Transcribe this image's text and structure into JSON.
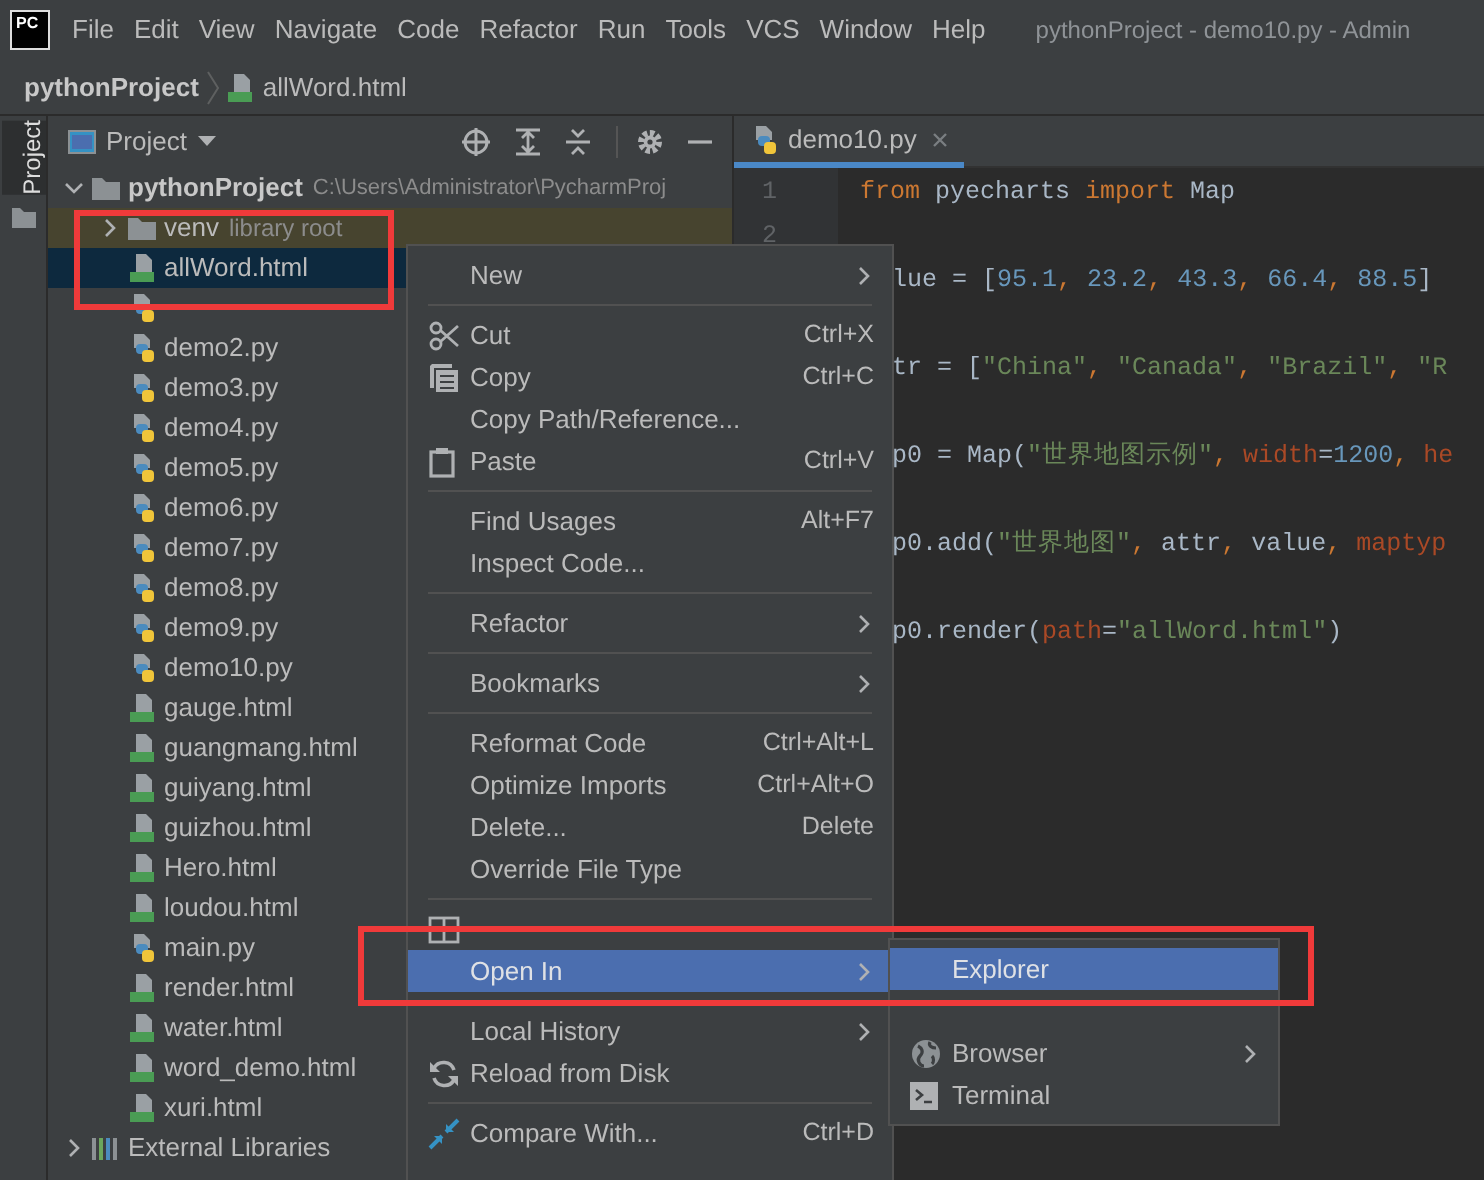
{
  "menu_bar": {
    "logo": "PC",
    "items": [
      "File",
      "Edit",
      "View",
      "Navigate",
      "Code",
      "Refactor",
      "Run",
      "Tools",
      "VCS",
      "Window",
      "Help"
    ],
    "title": "pythonProject - demo10.py - Admin"
  },
  "breadcrumb": [
    {
      "label": "pythonProject",
      "kind": "project"
    },
    {
      "label": "allWord.html",
      "kind": "html"
    }
  ],
  "tool_strip": {
    "tabs": [
      {
        "label": "Project",
        "selected": true
      }
    ]
  },
  "project_panel": {
    "title": "Project",
    "tree": [
      {
        "label": "pythonProject",
        "kind": "folder",
        "path": "C:\\Users\\Administrator\\PycharmProj",
        "expanded": true,
        "selected": false,
        "children": [
          {
            "label": "venv",
            "note": "library root",
            "kind": "folder",
            "expanded": false,
            "excluded": true,
            "selected": false
          },
          {
            "label": "allWord.html",
            "kind": "html",
            "selected": true
          },
          {
            "kind": "py",
            "selected": false
          },
          {
            "label": "demo2.py",
            "kind": "py",
            "selected": false
          },
          {
            "label": "demo3.py",
            "kind": "py",
            "selected": false
          },
          {
            "label": "demo4.py",
            "kind": "py",
            "selected": false
          },
          {
            "label": "demo5.py",
            "kind": "py",
            "selected": false
          },
          {
            "label": "demo6.py",
            "kind": "py",
            "selected": false
          },
          {
            "label": "demo7.py",
            "kind": "py",
            "selected": false
          },
          {
            "label": "demo8.py",
            "kind": "py",
            "selected": false
          },
          {
            "label": "demo9.py",
            "kind": "py",
            "selected": false
          },
          {
            "label": "demo10.py",
            "kind": "py",
            "selected": false
          },
          {
            "label": "gauge.html",
            "kind": "html",
            "selected": false
          },
          {
            "label": "guangmang.html",
            "kind": "html",
            "selected": false
          },
          {
            "label": "guiyang.html",
            "kind": "html",
            "selected": false
          },
          {
            "label": "guizhou.html",
            "kind": "html",
            "selected": false
          },
          {
            "label": "Hero.html",
            "kind": "html",
            "selected": false
          },
          {
            "label": "loudou.html",
            "kind": "html",
            "selected": false
          },
          {
            "label": "main.py",
            "kind": "py",
            "selected": false
          },
          {
            "label": "render.html",
            "kind": "html",
            "selected": false
          },
          {
            "label": "water.html",
            "kind": "html",
            "selected": false
          },
          {
            "label": "word_demo.html",
            "kind": "html",
            "selected": false
          },
          {
            "label": "xuri.html",
            "kind": "html",
            "selected": false
          }
        ]
      },
      {
        "label": "External Libraries",
        "kind": "library",
        "expanded": false,
        "selected": false
      }
    ]
  },
  "editor": {
    "tabs": [
      {
        "label": "demo10.py",
        "selected": true
      }
    ],
    "line_numbers": [
      "1",
      "2"
    ],
    "lines": [
      {
        "tokens": [
          {
            "text": "from",
            "kind": "keyword"
          },
          {
            "text": " pyecharts ",
            "kind": "plain"
          },
          {
            "text": "import",
            "kind": "keyword"
          },
          {
            "text": " Map",
            "kind": "plain"
          }
        ]
      },
      {
        "tokens": [
          {
            "text": "lue = [",
            "kind": "plain"
          },
          {
            "text": "95.1",
            "kind": "number"
          },
          {
            "text": ", ",
            "kind": "keyword"
          },
          {
            "text": "23.2",
            "kind": "number"
          },
          {
            "text": ", ",
            "kind": "keyword"
          },
          {
            "text": "43.3",
            "kind": "number"
          },
          {
            "text": ", ",
            "kind": "keyword"
          },
          {
            "text": "66.4",
            "kind": "number"
          },
          {
            "text": ", ",
            "kind": "keyword"
          },
          {
            "text": "88.5",
            "kind": "number"
          },
          {
            "text": "]",
            "kind": "plain"
          }
        ]
      },
      {
        "tokens": [
          {
            "text": "tr = [",
            "kind": "plain"
          },
          {
            "text": "\"China\"",
            "kind": "string"
          },
          {
            "text": ", ",
            "kind": "keyword"
          },
          {
            "text": "\"Canada\"",
            "kind": "string"
          },
          {
            "text": ", ",
            "kind": "keyword"
          },
          {
            "text": "\"Brazil\"",
            "kind": "string"
          },
          {
            "text": ", ",
            "kind": "keyword"
          },
          {
            "text": "\"R",
            "kind": "string"
          }
        ]
      },
      {
        "tokens": [
          {
            "text": "p0 = Map(",
            "kind": "plain"
          },
          {
            "text": "\"世界地图示例\"",
            "kind": "string"
          },
          {
            "text": ", ",
            "kind": "keyword"
          },
          {
            "text": "width",
            "kind": "param"
          },
          {
            "text": "=",
            "kind": "plain"
          },
          {
            "text": "1200",
            "kind": "number"
          },
          {
            "text": ", ",
            "kind": "keyword"
          },
          {
            "text": "he",
            "kind": "param"
          }
        ]
      },
      {
        "tokens": [
          {
            "text": "p0.add(",
            "kind": "plain"
          },
          {
            "text": "\"世界地图\"",
            "kind": "string"
          },
          {
            "text": ", ",
            "kind": "keyword"
          },
          {
            "text": "attr",
            "kind": "plain"
          },
          {
            "text": ", ",
            "kind": "keyword"
          },
          {
            "text": "value",
            "kind": "plain"
          },
          {
            "text": ", ",
            "kind": "keyword"
          },
          {
            "text": "maptyp",
            "kind": "param"
          }
        ]
      },
      {
        "tokens": [
          {
            "text": "p0.render(",
            "kind": "plain"
          },
          {
            "text": "path",
            "kind": "param"
          },
          {
            "text": "=",
            "kind": "plain"
          },
          {
            "text": "\"allWord.html\"",
            "kind": "string"
          },
          {
            "text": ")",
            "kind": "plain"
          }
        ]
      }
    ]
  },
  "context_menu": {
    "items": [
      {
        "kind": "item",
        "label": "New",
        "has_submenu": true,
        "selected": false
      },
      {
        "kind": "separator"
      },
      {
        "kind": "item",
        "label": "Cut",
        "shortcut": "Ctrl+X",
        "has_submenu": false,
        "selected": false
      },
      {
        "kind": "item",
        "label": "Copy",
        "shortcut": "Ctrl+C",
        "has_submenu": false,
        "selected": false
      },
      {
        "kind": "item",
        "label": "Copy Path/Reference...",
        "has_submenu": false,
        "selected": false
      },
      {
        "kind": "item",
        "label": "Paste",
        "shortcut": "Ctrl+V",
        "has_submenu": false,
        "selected": false
      },
      {
        "kind": "separator"
      },
      {
        "kind": "item",
        "label": "Find Usages",
        "shortcut": "Alt+F7",
        "has_submenu": false,
        "selected": false
      },
      {
        "kind": "item",
        "label": "Inspect Code...",
        "has_submenu": false,
        "selected": false
      },
      {
        "kind": "separator"
      },
      {
        "kind": "item",
        "label": "Refactor",
        "has_submenu": true,
        "selected": false
      },
      {
        "kind": "separator"
      },
      {
        "kind": "item",
        "label": "Bookmarks",
        "has_submenu": true,
        "selected": false
      },
      {
        "kind": "separator"
      },
      {
        "kind": "item",
        "label": "Reformat Code",
        "shortcut": "Ctrl+Alt+L",
        "has_submenu": false,
        "selected": false
      },
      {
        "kind": "item",
        "label": "Optimize Imports",
        "shortcut": "Ctrl+Alt+O",
        "has_submenu": false,
        "selected": false
      },
      {
        "kind": "item",
        "label": "Delete...",
        "shortcut": "Delete",
        "has_submenu": false,
        "selected": false
      },
      {
        "kind": "item",
        "label": "Override File Type",
        "has_submenu": false,
        "selected": false
      },
      {
        "kind": "separator"
      },
      {
        "kind": "item",
        "has_submenu": false,
        "selected": false
      },
      {
        "kind": "item",
        "label": "Open In",
        "has_submenu": true,
        "selected": true
      },
      {
        "kind": "separator"
      },
      {
        "kind": "item",
        "label": "Local History",
        "has_submenu": true,
        "selected": false
      },
      {
        "kind": "item",
        "label": "Reload from Disk",
        "has_submenu": false,
        "selected": false
      },
      {
        "kind": "separator"
      },
      {
        "kind": "item",
        "label": "Compare With...",
        "shortcut": "Ctrl+D",
        "has_submenu": false,
        "selected": false
      }
    ]
  },
  "submenu": {
    "items": [
      {
        "kind": "item",
        "label": "Explorer",
        "has_submenu": false,
        "selected": true
      },
      {
        "kind": "item",
        "has_submenu": false,
        "selected": false
      },
      {
        "kind": "item",
        "label": "Browser",
        "has_submenu": true,
        "selected": false
      },
      {
        "kind": "item",
        "label": "Terminal",
        "has_submenu": false,
        "selected": false
      }
    ]
  }
}
